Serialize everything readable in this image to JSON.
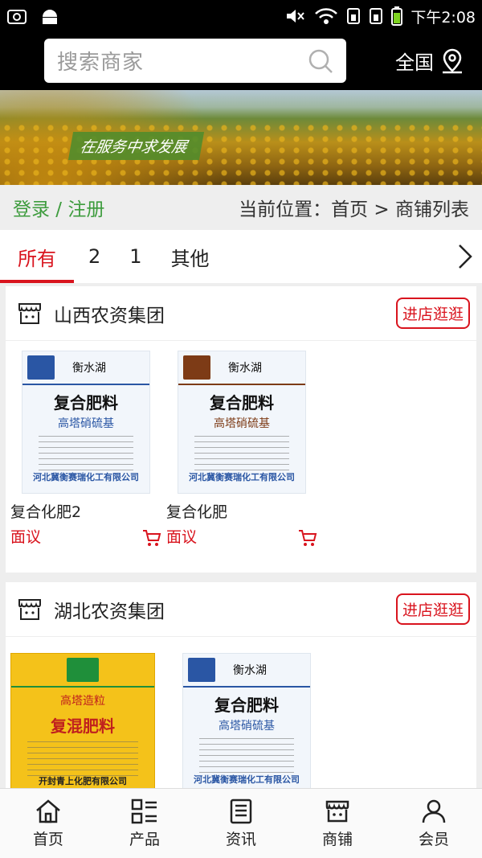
{
  "status_bar": {
    "time": "下午2:08",
    "left_icons": [
      "screenshot-icon",
      "android-icon"
    ],
    "right_icons": [
      "mute-icon",
      "wifi-icon",
      "sim1-icon",
      "sim2-icon",
      "battery-icon"
    ]
  },
  "header": {
    "search_placeholder": "搜索商家",
    "region_label": "全国"
  },
  "banner": {
    "slogan": "在服务中求发展"
  },
  "breadcrumb_bar": {
    "login_register": "登录 / 注册",
    "location": "当前位置：首页 > 商铺列表"
  },
  "tabs": [
    {
      "label": "所有",
      "active": true
    },
    {
      "label": "2",
      "active": false
    },
    {
      "label": "1",
      "active": false
    },
    {
      "label": "其他",
      "active": false
    }
  ],
  "stores": [
    {
      "name": "山西农资集团",
      "enter_label": "进店逛逛",
      "goods": [
        {
          "name": "复合化肥2",
          "price": "面议",
          "bag": {
            "brand": "衡水湖",
            "title": "复合肥料",
            "sub": "高塔硝硫基",
            "footer": "河北冀衡赛瑞化工有限公司"
          }
        },
        {
          "name": "复合化肥",
          "price": "面议",
          "bag": {
            "brand": "衡水湖",
            "title": "复合肥料",
            "sub": "高塔硝硫基",
            "footer": "河北冀衡赛瑞化工有限公司"
          }
        }
      ]
    },
    {
      "name": "湖北农资集团",
      "enter_label": "进店逛逛",
      "goods": [
        {
          "name": "",
          "price": "",
          "bag": {
            "brand": "",
            "title": "复混肥料",
            "sub": "高塔造粒",
            "footer": "开封青上化肥有限公司"
          }
        },
        {
          "name": "",
          "price": "",
          "bag": {
            "brand": "衡水湖",
            "title": "复合肥料",
            "sub": "高塔硝硫基",
            "footer": "河北冀衡赛瑞化工有限公司"
          }
        }
      ]
    }
  ],
  "bottom_nav": [
    {
      "label": "首页",
      "icon": "home-icon"
    },
    {
      "label": "产品",
      "icon": "grid-list-icon"
    },
    {
      "label": "资讯",
      "icon": "news-icon"
    },
    {
      "label": "商铺",
      "icon": "shop-icon"
    },
    {
      "label": "会员",
      "icon": "user-icon"
    }
  ],
  "colors": {
    "accent": "#d9141e",
    "login_green": "#3e9c3e",
    "status_bg": "#000000"
  }
}
